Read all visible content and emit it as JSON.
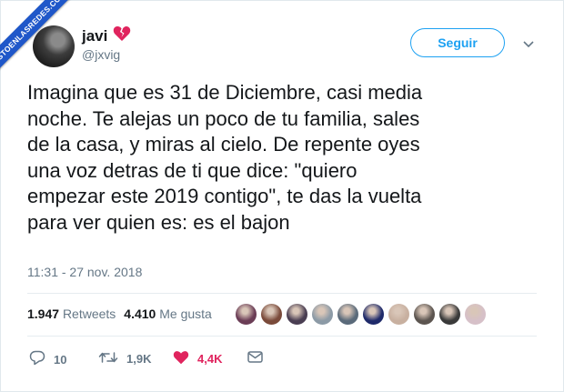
{
  "watermark": "VISTOENLASREDES.COM",
  "user": {
    "name": "javi",
    "emoji": "💔",
    "handle": "@jxvig"
  },
  "follow_label": "Seguir",
  "tweet_lines": [
    "Imagina que es 31 de Diciembre, casi media",
    "noche. Te alejas un poco de tu familia, sales",
    "de la casa, y miras al cielo. De repente oyes",
    "una voz detras de ti que dice: \"quiero",
    "empezar este 2019 contigo\", te das la vuelta",
    "para ver quien es: es el bajon"
  ],
  "timestamp": "11:31 - 27 nov. 2018",
  "stats": {
    "retweets_count": "1.947",
    "retweets_label": "Retweets",
    "likes_count": "4.410",
    "likes_label": "Me gusta"
  },
  "likers": [
    "#6b3d56",
    "#7a4a3a",
    "#4a3e52",
    "#8c9aa6",
    "#5a6a7a",
    "#1f2a6a",
    "#c8b0a0",
    "#5c5550",
    "#3a3a3a",
    "#d6c0c8"
  ],
  "actions": {
    "replies": "10",
    "retweets": "1,9K",
    "likes": "4,4K"
  },
  "colors": {
    "accent": "#1da1f2",
    "like": "#e0245e",
    "muted": "#657786",
    "ribbon": "#1f57c9"
  }
}
